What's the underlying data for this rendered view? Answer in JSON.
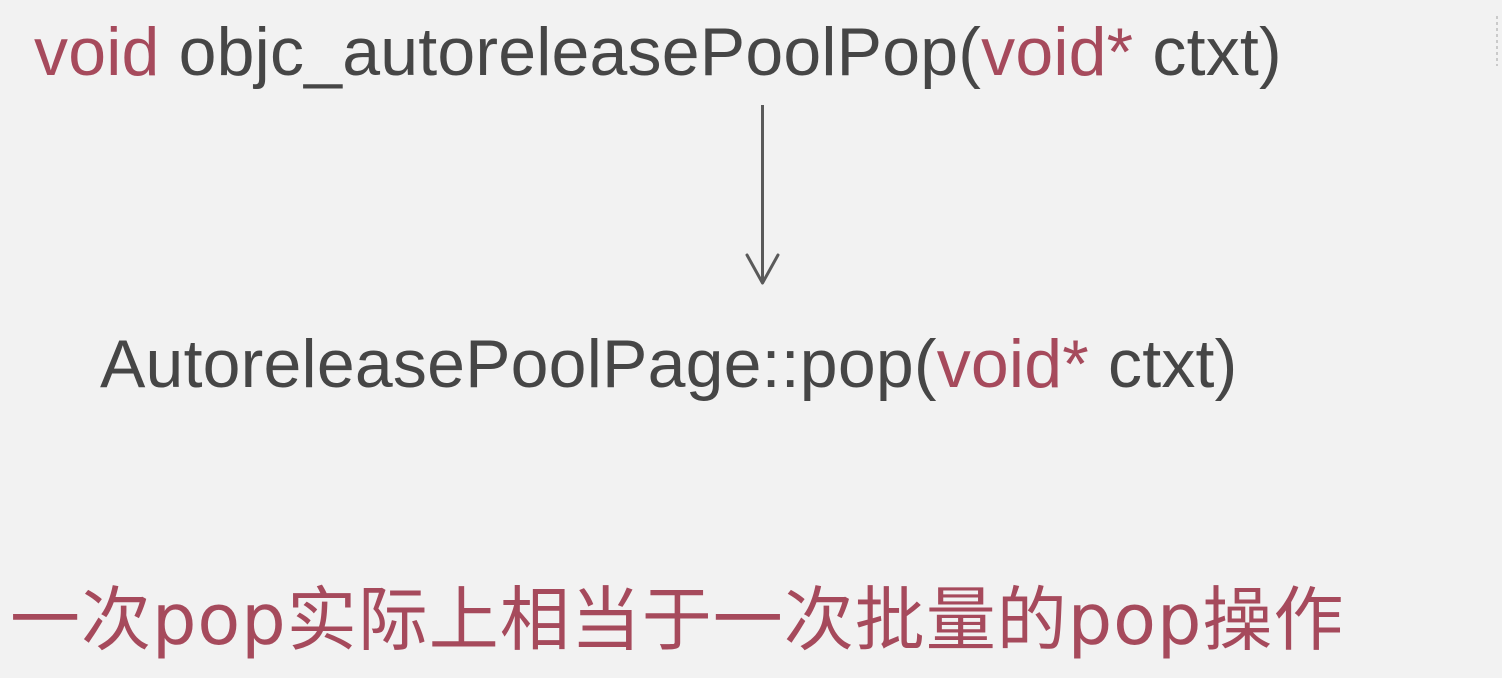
{
  "top_signature": {
    "return_type": "void",
    "function_name": " objc_autoreleasePoolPop(",
    "param_type": "void*",
    "param_rest": " ctxt)"
  },
  "bottom_signature": {
    "function_name": "AutoreleasePoolPage::pop(",
    "param_type": "void*",
    "param_rest": " ctxt)"
  },
  "caption": "一次pop实际上相当于一次批量的pop操作",
  "colors": {
    "keyword": "#a64a5c",
    "code_text": "#464646",
    "arrow": "#5a5a5a",
    "background": "#f2f2f2"
  },
  "icons": {
    "arrow": "down-arrow-icon"
  }
}
